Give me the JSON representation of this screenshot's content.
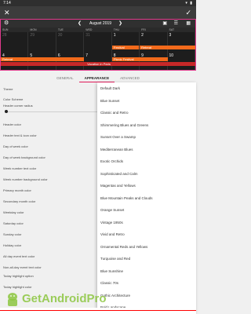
{
  "status_bar": {
    "time": "7:14",
    "icons": "▾ ▮"
  },
  "app_bar": {
    "close_glyph": "✕",
    "check_glyph": "✓"
  },
  "calendar": {
    "settings_glyph": "⚙",
    "prev": "❮",
    "month": "August 2019",
    "next": "❯",
    "top_icons": [
      "▣",
      "☰",
      "▦"
    ],
    "weekdays": [
      "SUN",
      "MON",
      "TUE",
      "WED",
      "THU",
      "FRI",
      "SAT"
    ],
    "week1": [
      "28",
      "29",
      "30",
      "31",
      "1",
      "2",
      "3"
    ],
    "week2": [
      "4",
      "5",
      "6",
      "7",
      "8",
      "9",
      "10"
    ],
    "events": {
      "e1": "Festival",
      "e2": "Retreat",
      "e3": "Picnic Festival",
      "e4": "Retreat",
      "e5": "Vacation in Paris"
    }
  },
  "tabs": [
    {
      "label": "GENERAL"
    },
    {
      "label": "APPEARANCE",
      "active": true
    },
    {
      "label": "ADVANCED"
    }
  ],
  "settings": {
    "theme": "Theme",
    "color_scheme": "Color Scheme",
    "header_corner_radius": "Header corner radius",
    "header_color": "Header color",
    "header_text_icon_color": "Header text & icon color",
    "day_of_week_color": "Day of week color",
    "day_of_week_bg": "Day of week background color",
    "week_number_text": "Week number text color",
    "week_number_bg": "Week number background color",
    "primary_month": "Primary month color",
    "secondary_month": "Secondary month color",
    "weekday_color": "Weekday color",
    "saturday_color": "Saturday color",
    "sunday_color": "Sunday color",
    "holiday_color": "Holiday color",
    "all_day_event": "All day event text color",
    "non_all_day_event": "Non-all-day event text color",
    "today_highlight": "Today highlight option",
    "today_highlight_color": "Today highlight color"
  },
  "swatches": {
    "header_color": "#607d8b",
    "week_number_bg": "#333333",
    "primary_month": "#2b2b2b",
    "secondary_month": "#4a4a4a",
    "saturday": "#333333",
    "sunday": "#e02020",
    "holiday": "#e02020",
    "today_highlight": "#3a5bd9"
  },
  "dropdown": {
    "options": [
      "Default Dark",
      "Blue Sunset",
      "Classic and Retro",
      "Shimmering Blues and Greens",
      "Sunset Over a Swamp",
      "Mediterranean Blues",
      "Exotic Orchids",
      "Sophisticated and Calm",
      "Magentas and Yellows",
      "Blue Mountain Peaks and Clouds",
      "Orange Sunset",
      "Vintage 1950s",
      "Vivid and Retro",
      "Ornamental Reds and Yellows",
      "Turquoise and Red",
      "Blue Sunshine",
      "Classic 70s",
      "Gothic Architecture",
      "Bold Landscape"
    ]
  },
  "watermark": {
    "text": "GetAndroidPro"
  },
  "colors": {
    "accent": "#e01a5a",
    "event_red": "#c62828",
    "event_orange": "#f26a1b",
    "event_maroon": "#7b1a1a"
  }
}
